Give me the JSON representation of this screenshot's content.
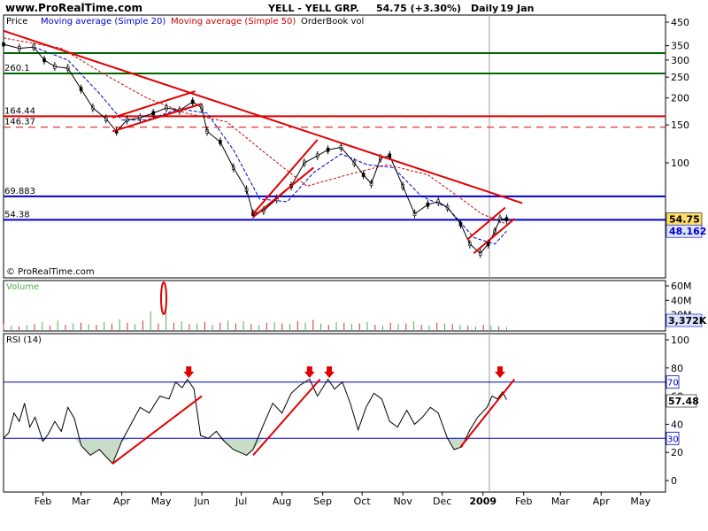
{
  "header": {
    "site": "www.ProRealTime.com",
    "instrument": "YELL - YELL GRP.",
    "price_change": "54.75 (+3.30%)",
    "period": "Daily",
    "date": "19 Jan"
  },
  "colors": {
    "price": "#000000",
    "ma20": "#0000cc",
    "ma50": "#cc0000",
    "green_line": "#006600",
    "red_line": "#e00000",
    "blue_line": "#0000cc",
    "volume": "#55aa55",
    "rsi_fill": "#c8dcc8",
    "current_bg": "#ffdd66",
    "ma20_bg": "#dde4ff"
  },
  "chart_data": {
    "type": "line",
    "price_panel": {
      "legend": [
        "Price",
        "Moving average (Simple 20)",
        "Moving average (Simple 50)",
        "OrderBook vol"
      ],
      "y_ticks": [
        450,
        350,
        300,
        250,
        200,
        150,
        100
      ],
      "scale": "log",
      "current_price_label": "54.75",
      "ma20_value_label": "48.162",
      "horizontal_lines": [
        {
          "label": "",
          "value": 323,
          "color": "green"
        },
        {
          "label": "260.1",
          "value": 260.1,
          "color": "green"
        },
        {
          "label": "164.44",
          "value": 164.44,
          "color": "red"
        },
        {
          "label": "146.37",
          "value": 146.37,
          "color": "red-dashed"
        },
        {
          "label": "69.883",
          "value": 69.883,
          "color": "blue"
        },
        {
          "label": "54.38",
          "value": 54.38,
          "color": "blue"
        }
      ],
      "copyright": "© ProRealTime.com",
      "price_series": [
        [
          "2008-01-02",
          355
        ],
        [
          "2008-01-14",
          340
        ],
        [
          "2008-01-25",
          345
        ],
        [
          "2008-02-02",
          300
        ],
        [
          "2008-02-10",
          280
        ],
        [
          "2008-02-20",
          275
        ],
        [
          "2008-03-01",
          220
        ],
        [
          "2008-03-10",
          180
        ],
        [
          "2008-03-20",
          160
        ],
        [
          "2008-03-28",
          140
        ],
        [
          "2008-04-05",
          158
        ],
        [
          "2008-04-15",
          162
        ],
        [
          "2008-04-25",
          170
        ],
        [
          "2008-05-05",
          180
        ],
        [
          "2008-05-15",
          175
        ],
        [
          "2008-05-25",
          192
        ],
        [
          "2008-06-01",
          180
        ],
        [
          "2008-06-05",
          140
        ],
        [
          "2008-06-15",
          125
        ],
        [
          "2008-06-25",
          95
        ],
        [
          "2008-07-05",
          75
        ],
        [
          "2008-07-10",
          58
        ],
        [
          "2008-07-18",
          60
        ],
        [
          "2008-07-28",
          68
        ],
        [
          "2008-08-08",
          78
        ],
        [
          "2008-08-18",
          100
        ],
        [
          "2008-08-28",
          108
        ],
        [
          "2008-09-05",
          115
        ],
        [
          "2008-09-15",
          118
        ],
        [
          "2008-09-25",
          100
        ],
        [
          "2008-10-02",
          88
        ],
        [
          "2008-10-08",
          80
        ],
        [
          "2008-10-15",
          105
        ],
        [
          "2008-10-22",
          108
        ],
        [
          "2008-11-01",
          78
        ],
        [
          "2008-11-10",
          58
        ],
        [
          "2008-11-20",
          64
        ],
        [
          "2008-11-28",
          66
        ],
        [
          "2008-12-05",
          62
        ],
        [
          "2008-12-15",
          52
        ],
        [
          "2008-12-22",
          42
        ],
        [
          "2008-12-30",
          38
        ],
        [
          "2009-01-05",
          42
        ],
        [
          "2009-01-10",
          48
        ],
        [
          "2009-01-14",
          55
        ],
        [
          "2009-01-19",
          54.75
        ]
      ],
      "ma20": [
        [
          "2008-01-25",
          345
        ],
        [
          "2008-02-20",
          300
        ],
        [
          "2008-03-15",
          210
        ],
        [
          "2008-04-01",
          158
        ],
        [
          "2008-04-20",
          158
        ],
        [
          "2008-05-15",
          178
        ],
        [
          "2008-06-05",
          170
        ],
        [
          "2008-06-25",
          115
        ],
        [
          "2008-07-15",
          68
        ],
        [
          "2008-08-05",
          66
        ],
        [
          "2008-08-25",
          90
        ],
        [
          "2008-09-15",
          110
        ],
        [
          "2008-10-05",
          98
        ],
        [
          "2008-10-25",
          95
        ],
        [
          "2008-11-15",
          70
        ],
        [
          "2008-12-05",
          62
        ],
        [
          "2008-12-25",
          45
        ],
        [
          "2009-01-10",
          42
        ],
        [
          "2009-01-19",
          48.162
        ]
      ],
      "ma50": [
        [
          "2008-01-02",
          380
        ],
        [
          "2008-02-15",
          340
        ],
        [
          "2008-03-20",
          255
        ],
        [
          "2008-04-20",
          200
        ],
        [
          "2008-05-20",
          170
        ],
        [
          "2008-06-20",
          155
        ],
        [
          "2008-07-20",
          110
        ],
        [
          "2008-08-20",
          78
        ],
        [
          "2008-09-20",
          88
        ],
        [
          "2008-10-20",
          98
        ],
        [
          "2008-11-20",
          88
        ],
        [
          "2008-12-10",
          72
        ],
        [
          "2008-12-31",
          58
        ],
        [
          "2009-01-19",
          52
        ]
      ],
      "trendlines": [
        {
          "from": [
            "2008-01-02",
            410
          ],
          "to": [
            "2009-01-31",
            65
          ]
        },
        {
          "from": [
            "2008-03-25",
            140
          ],
          "to": [
            "2008-06-01",
            188
          ]
        },
        {
          "from": [
            "2008-03-25",
            162
          ],
          "to": [
            "2008-05-27",
            215
          ]
        },
        {
          "from": [
            "2008-07-10",
            56
          ],
          "to": [
            "2008-08-25",
            95
          ]
        },
        {
          "from": [
            "2008-07-10",
            58
          ],
          "to": [
            "2008-08-28",
            128
          ]
        },
        {
          "from": [
            "2008-12-25",
            38
          ],
          "to": [
            "2009-01-25",
            55
          ]
        },
        {
          "from": [
            "2008-12-20",
            44
          ],
          "to": [
            "2009-01-18",
            62
          ]
        }
      ]
    },
    "volume_panel": {
      "label": "Volume",
      "y_ticks": [
        "60M",
        "40M",
        "20M"
      ],
      "current_label": "3,372K",
      "values_m": [
        8,
        5,
        4,
        6,
        7,
        10,
        5,
        12,
        6,
        8,
        9,
        7,
        6,
        10,
        8,
        14,
        9,
        7,
        12,
        25,
        8,
        30,
        9,
        11,
        7,
        8,
        10,
        6,
        9,
        12,
        8,
        11,
        7,
        6,
        9,
        10,
        8,
        7,
        11,
        9,
        13,
        8,
        6,
        10,
        9,
        7,
        8,
        10,
        6,
        5,
        9,
        7,
        8,
        11,
        6,
        5,
        9,
        8,
        7,
        6,
        5,
        4,
        6,
        5,
        4,
        3
      ],
      "spike_marker_value_m": 55
    },
    "rsi_panel": {
      "label": "RSI (14)",
      "y_ticks": [
        100,
        80,
        60,
        40,
        20,
        0
      ],
      "overbought_label": "70",
      "oversold_label": "30",
      "current_label": "57.48",
      "series": [
        [
          "2008-01-02",
          30
        ],
        [
          "2008-01-06",
          34
        ],
        [
          "2008-01-10",
          48
        ],
        [
          "2008-01-14",
          42
        ],
        [
          "2008-01-18",
          55
        ],
        [
          "2008-01-22",
          38
        ],
        [
          "2008-01-26",
          45
        ],
        [
          "2008-02-01",
          28
        ],
        [
          "2008-02-05",
          33
        ],
        [
          "2008-02-10",
          42
        ],
        [
          "2008-02-15",
          35
        ],
        [
          "2008-02-20",
          52
        ],
        [
          "2008-02-25",
          44
        ],
        [
          "2008-03-01",
          25
        ],
        [
          "2008-03-08",
          18
        ],
        [
          "2008-03-15",
          22
        ],
        [
          "2008-03-25",
          12
        ],
        [
          "2008-04-01",
          28
        ],
        [
          "2008-04-08",
          40
        ],
        [
          "2008-04-15",
          52
        ],
        [
          "2008-04-22",
          48
        ],
        [
          "2008-04-30",
          60
        ],
        [
          "2008-05-07",
          58
        ],
        [
          "2008-05-12",
          70
        ],
        [
          "2008-05-17",
          66
        ],
        [
          "2008-05-21",
          72
        ],
        [
          "2008-05-26",
          65
        ],
        [
          "2008-05-31",
          32
        ],
        [
          "2008-06-06",
          30
        ],
        [
          "2008-06-12",
          35
        ],
        [
          "2008-06-18",
          28
        ],
        [
          "2008-06-25",
          22
        ],
        [
          "2008-07-05",
          18
        ],
        [
          "2008-07-10",
          22
        ],
        [
          "2008-07-18",
          40
        ],
        [
          "2008-07-25",
          55
        ],
        [
          "2008-08-01",
          48
        ],
        [
          "2008-08-08",
          62
        ],
        [
          "2008-08-15",
          68
        ],
        [
          "2008-08-22",
          72
        ],
        [
          "2008-08-28",
          60
        ],
        [
          "2008-09-05",
          72
        ],
        [
          "2008-09-10",
          65
        ],
        [
          "2008-09-16",
          70
        ],
        [
          "2008-09-22",
          55
        ],
        [
          "2008-09-28",
          36
        ],
        [
          "2008-10-04",
          52
        ],
        [
          "2008-10-10",
          62
        ],
        [
          "2008-10-16",
          58
        ],
        [
          "2008-10-22",
          42
        ],
        [
          "2008-10-28",
          38
        ],
        [
          "2008-11-04",
          50
        ],
        [
          "2008-11-10",
          40
        ],
        [
          "2008-11-16",
          45
        ],
        [
          "2008-11-22",
          52
        ],
        [
          "2008-11-28",
          48
        ],
        [
          "2008-12-05",
          30
        ],
        [
          "2008-12-10",
          22
        ],
        [
          "2008-12-16",
          24
        ],
        [
          "2008-12-22",
          36
        ],
        [
          "2008-12-28",
          45
        ],
        [
          "2009-01-04",
          52
        ],
        [
          "2009-01-08",
          60
        ],
        [
          "2009-01-12",
          58
        ],
        [
          "2009-01-16",
          63
        ],
        [
          "2009-01-19",
          57.48
        ]
      ],
      "trendlines": [
        {
          "from": [
            "2008-03-25",
            12
          ],
          "to": [
            "2008-06-01",
            60
          ]
        },
        {
          "from": [
            "2008-07-10",
            18
          ],
          "to": [
            "2008-08-30",
            72
          ]
        },
        {
          "from": [
            "2008-12-15",
            24
          ],
          "to": [
            "2009-01-25",
            72
          ]
        }
      ],
      "arrow_dates": [
        "2008-05-22",
        "2008-08-22",
        "2008-09-06",
        "2009-01-14"
      ]
    },
    "x_ticks": [
      "Feb",
      "Mar",
      "Apr",
      "May",
      "Jun",
      "Jul",
      "Aug",
      "Sep",
      "Oct",
      "Nov",
      "Dec",
      "2009",
      "Feb",
      "Mar",
      "Apr",
      "May"
    ],
    "x_tick_dates": [
      "2008-02-01",
      "2008-03-01",
      "2008-04-01",
      "2008-05-01",
      "2008-06-01",
      "2008-07-01",
      "2008-08-01",
      "2008-09-01",
      "2008-10-01",
      "2008-11-01",
      "2008-12-01",
      "2009-01-01",
      "2009-02-01",
      "2009-03-01",
      "2009-04-01",
      "2009-05-01"
    ],
    "x_range": [
      "2008-01-02",
      "2009-05-20"
    ]
  }
}
